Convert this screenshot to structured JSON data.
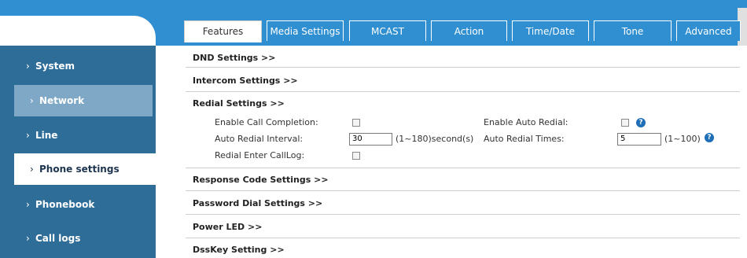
{
  "tabs": [
    "Features",
    "Media Settings",
    "MCAST",
    "Action",
    "Time/Date",
    "Tone",
    "Advanced"
  ],
  "sidebar": {
    "items": [
      "System",
      "Network",
      "Line",
      "Phone settings",
      "Phonebook",
      "Call logs"
    ]
  },
  "sections": {
    "dnd": "DND Settings >>",
    "intercom": "Intercom Settings >>",
    "redial": "Redial Settings >>",
    "response": "Response Code Settings >>",
    "password": "Password Dial Settings >>",
    "power": "Power LED >>",
    "dsskey": "DssKey Setting >>"
  },
  "redial": {
    "enable_call_completion": "Enable Call Completion:",
    "auto_redial_interval": "Auto Redial Interval:",
    "interval_value": "30",
    "interval_range": "(1~180)second(s)",
    "redial_enter_calllog": "Redial Enter CallLog:",
    "enable_auto_redial": "Enable Auto Redial:",
    "auto_redial_times": "Auto Redial Times:",
    "times_value": "5",
    "times_range": "(1~100)"
  },
  "icons": {
    "help": "help-icon",
    "chevron": "chevron-right-icon"
  },
  "colors": {
    "accent": "#2f8fd1",
    "sidebar": "#2f6d99",
    "help": "#1f6fb8"
  }
}
